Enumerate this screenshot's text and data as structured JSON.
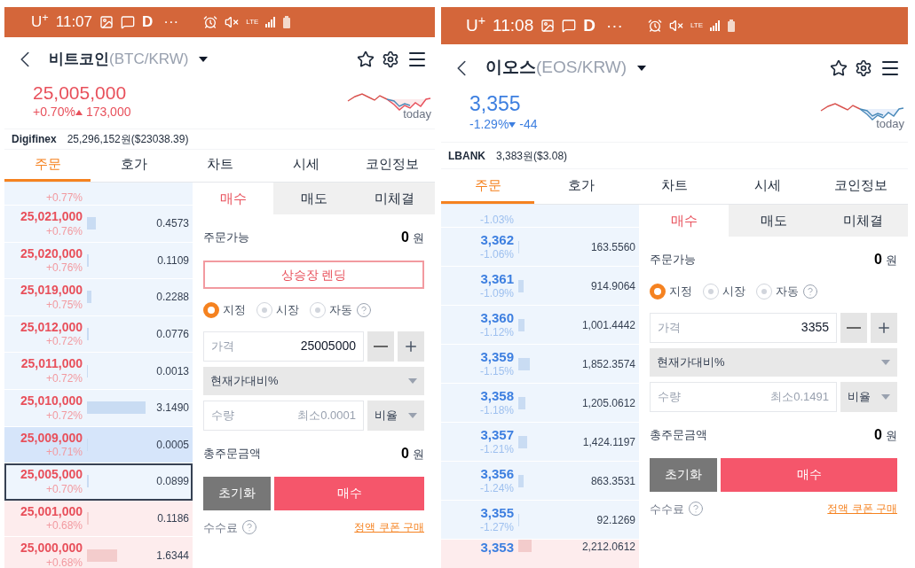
{
  "phones": [
    {
      "status": {
        "carrier": "U$^{+}$",
        "time": "11:07",
        "app_letter": "D",
        "more": "···",
        "network": "LTE"
      },
      "header": {
        "name": "비트코인",
        "pair": "(BTC/KRW)"
      },
      "price": {
        "value": "25,005,000",
        "change_pct": "+0.70%",
        "change_abs": "173,000",
        "rising": true,
        "sparkline_label": "today"
      },
      "exchange": {
        "name": "Digifinex",
        "price": "25,296,152원($23038.39)"
      },
      "tabs": [
        {
          "label": "주문",
          "selected": true
        },
        {
          "label": "호가",
          "selected": false
        },
        {
          "label": "차트",
          "selected": false
        },
        {
          "label": "시세",
          "selected": false
        },
        {
          "label": "코인정보",
          "selected": false
        }
      ],
      "orderbook": [
        {
          "kind": "ask",
          "pct": "+0.77%",
          "highlighted": false,
          "current": false
        },
        {
          "kind": "ask",
          "price": "25,021,000",
          "pct": "+0.76%",
          "qty": "0.4573",
          "highlighted": false,
          "current": false
        },
        {
          "kind": "ask",
          "price": "25,020,000",
          "pct": "+0.76%",
          "qty": "0.1109",
          "highlighted": false,
          "current": false
        },
        {
          "kind": "ask",
          "price": "25,019,000",
          "pct": "+0.75%",
          "qty": "0.2288",
          "highlighted": false,
          "current": false
        },
        {
          "kind": "ask",
          "price": "25,012,000",
          "pct": "+0.72%",
          "qty": "0.0776",
          "highlighted": false,
          "current": false
        },
        {
          "kind": "ask",
          "price": "25,011,000",
          "pct": "+0.72%",
          "qty": "0.0013",
          "highlighted": false,
          "current": false
        },
        {
          "kind": "ask",
          "price": "25,010,000",
          "pct": "+0.72%",
          "qty": "3.1490",
          "highlighted": false,
          "current": false
        },
        {
          "kind": "ask",
          "price": "25,009,000",
          "pct": "+0.71%",
          "qty": "0.0005",
          "highlighted": true,
          "current": false
        },
        {
          "kind": "ask",
          "price": "25,005,000",
          "pct": "+0.70%",
          "qty": "0.0899",
          "highlighted": false,
          "current": true
        },
        {
          "kind": "bid",
          "price": "25,001,000",
          "pct": "+0.68%",
          "qty": "0.1186",
          "highlighted": false,
          "current": false
        },
        {
          "kind": "bid",
          "price": "25,000,000",
          "pct": "+0.68%",
          "qty": "1.6344",
          "highlighted": false,
          "current": false
        }
      ],
      "order_panel": {
        "tabs": [
          {
            "label": "매수",
            "selected": true
          },
          {
            "label": "매도",
            "selected": false
          },
          {
            "label": "미체결",
            "selected": false
          }
        ],
        "available_label": "주문가능",
        "available_value": "0",
        "available_unit": "원",
        "lending_button": "상승장 렌딩",
        "order_types": [
          {
            "label": "지정",
            "selected": true
          },
          {
            "label": "시장",
            "selected": false
          },
          {
            "label": "자동",
            "selected": false
          }
        ],
        "price_label": "가격",
        "price_value": "25005000",
        "percent_select": "현재가대비%",
        "qty_label": "수량",
        "qty_placeholder": "최소0.0001",
        "ratio_select": "비율",
        "total_label": "총주문금액",
        "total_value": "0",
        "total_unit": "원",
        "reset_button": "초기화",
        "submit_button": "매수",
        "fee_label": "수수료",
        "coupon_link": "정액 쿠폰 구매"
      }
    },
    {
      "status": {
        "carrier": "U$^{+}$",
        "time": "11:08",
        "app_letter": "D",
        "more": "···",
        "network": "LTE"
      },
      "header": {
        "name": "이오스",
        "pair": "(EOS/KRW)"
      },
      "price": {
        "value": "3,355",
        "change_pct": "-1.29%",
        "change_abs": "-44",
        "rising": false,
        "sparkline_label": "today"
      },
      "exchange": {
        "name": "LBANK",
        "price": "3,383원($3.08)"
      },
      "tabs": [
        {
          "label": "주문",
          "selected": true
        },
        {
          "label": "호가",
          "selected": false
        },
        {
          "label": "차트",
          "selected": false
        },
        {
          "label": "시세",
          "selected": false
        },
        {
          "label": "코인정보",
          "selected": false
        }
      ],
      "orderbook": [
        {
          "kind": "ask",
          "pct": "-1.03%",
          "highlighted": false,
          "current": false
        },
        {
          "kind": "ask",
          "price": "3,362",
          "pct": "-1.06%",
          "qty": "163.5560",
          "highlighted": false,
          "current": false
        },
        {
          "kind": "ask",
          "price": "3,361",
          "pct": "-1.09%",
          "qty": "914.9064",
          "highlighted": false,
          "current": false
        },
        {
          "kind": "ask",
          "price": "3,360",
          "pct": "-1.12%",
          "qty": "1,001.4442",
          "highlighted": false,
          "current": false
        },
        {
          "kind": "ask",
          "price": "3,359",
          "pct": "-1.15%",
          "qty": "1,852.3574",
          "highlighted": false,
          "current": false
        },
        {
          "kind": "ask",
          "price": "3,358",
          "pct": "-1.18%",
          "qty": "1,205.0612",
          "highlighted": false,
          "current": false
        },
        {
          "kind": "ask",
          "price": "3,357",
          "pct": "-1.21%",
          "qty": "1,424.1197",
          "highlighted": false,
          "current": false
        },
        {
          "kind": "ask",
          "price": "3,356",
          "pct": "-1.24%",
          "qty": "863.3531",
          "highlighted": false,
          "current": false
        },
        {
          "kind": "ask",
          "price": "3,355",
          "pct": "-1.27%",
          "qty": "92.1269",
          "highlighted": false,
          "current": false
        },
        {
          "kind": "bid",
          "price": "3,353",
          "qty": "2,212.0612",
          "highlighted": false,
          "current": false
        }
      ],
      "order_panel": {
        "tabs": [
          {
            "label": "매수",
            "selected": true
          },
          {
            "label": "매도",
            "selected": false
          },
          {
            "label": "미체결",
            "selected": false
          }
        ],
        "available_label": "주문가능",
        "available_value": "0",
        "available_unit": "원",
        "order_types": [
          {
            "label": "지정",
            "selected": true
          },
          {
            "label": "시장",
            "selected": false
          },
          {
            "label": "자동",
            "selected": false
          }
        ],
        "price_label": "가격",
        "price_value": "3355",
        "percent_select": "현재가대비%",
        "qty_label": "수량",
        "qty_placeholder": "최소0.1491",
        "ratio_select": "비율",
        "total_label": "총주문금액",
        "total_value": "0",
        "total_unit": "원",
        "reset_button": "초기화",
        "submit_button": "매수",
        "fee_label": "수수료",
        "coupon_link": "정액 쿠폰 구매"
      }
    }
  ]
}
